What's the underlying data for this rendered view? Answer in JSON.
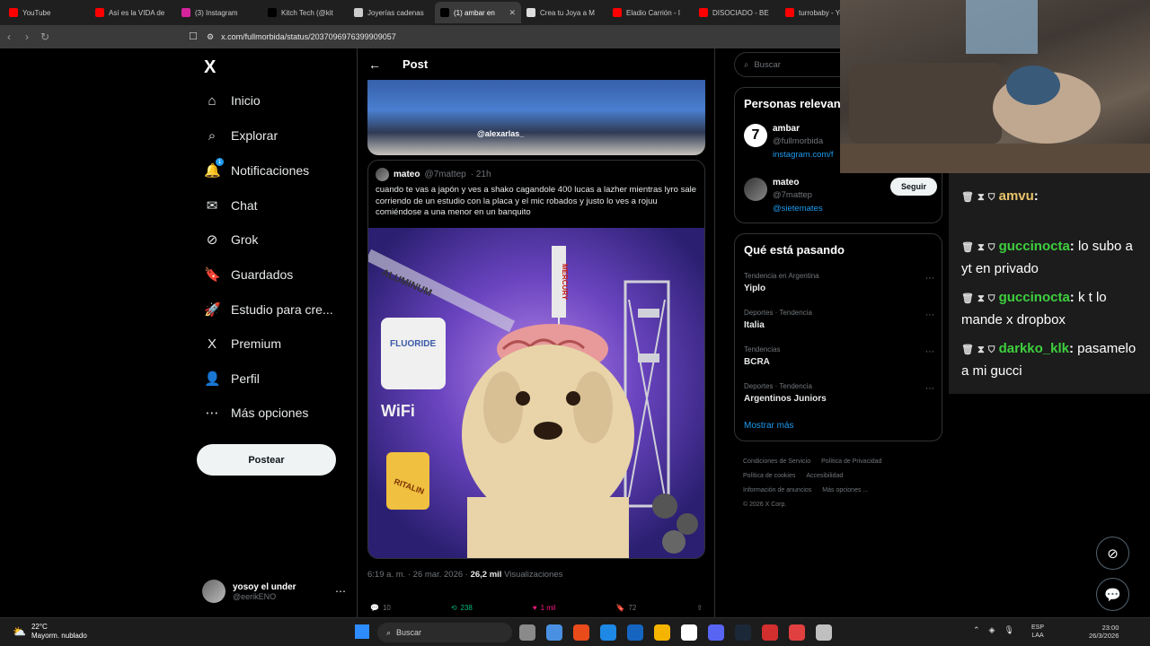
{
  "browser": {
    "tabs": [
      {
        "label": "YouTube",
        "color": "#ff0000"
      },
      {
        "label": "Así es la VIDA de",
        "color": "#ff0000"
      },
      {
        "label": "(3) Instagram",
        "color": "#d6249f"
      },
      {
        "label": "Kitch Tech (@kit",
        "color": "#000000"
      },
      {
        "label": "Joyerías cadenas",
        "color": "#cccccc"
      },
      {
        "label": "(1) ambar en",
        "color": "#000000",
        "active": true
      },
      {
        "label": "Crea tu Joya a M",
        "color": "#dddddd"
      },
      {
        "label": "Eladio Carrión - I",
        "color": "#ff0000"
      },
      {
        "label": "DISOCIADO - BE",
        "color": "#ff0000"
      },
      {
        "label": "turrobaby - You",
        "color": "#ff0000"
      }
    ],
    "url": "x.com/fullmorbida/status/2037096976399909057"
  },
  "sidebar": {
    "logo": "X",
    "items": [
      {
        "label": "Inicio",
        "icon": "home-icon",
        "glyph": "⌂"
      },
      {
        "label": "Explorar",
        "icon": "search-icon",
        "glyph": "⌕"
      },
      {
        "label": "Notificaciones",
        "icon": "bell-icon",
        "glyph": "🔔",
        "badge": "1"
      },
      {
        "label": "Chat",
        "icon": "mail-icon",
        "glyph": "✉"
      },
      {
        "label": "Grok",
        "icon": "grok-icon",
        "glyph": "⊘"
      },
      {
        "label": "Guardados",
        "icon": "bookmark-icon",
        "glyph": "🔖"
      },
      {
        "label": "Estudio para cre...",
        "icon": "rocket-icon",
        "glyph": "🚀"
      },
      {
        "label": "Premium",
        "icon": "x-icon",
        "glyph": "X"
      },
      {
        "label": "Perfil",
        "icon": "person-icon",
        "glyph": "👤"
      },
      {
        "label": "Más opciones",
        "icon": "more-icon",
        "glyph": "⋯"
      }
    ],
    "post_button": "Postear",
    "account": {
      "name": "yosoy el under",
      "handle": "@eerikENO"
    }
  },
  "main": {
    "title": "Post",
    "top_media_tag": "@alexarlas_",
    "quote": {
      "name": "mateo",
      "handle": "@7mattep",
      "time": "· 21h",
      "text": "cuando te vas a japón y ves a shako cagandole 400 lucas a lazher mientras lyro sale corriendo de un estudio con la placa y el mic robados y justo lo ves a rojuu comiéndose a una menor en un banquito",
      "image_words": [
        "ALUMINUM",
        "FLUORIDE",
        "MERCURY",
        "WiFi",
        "RITALIN"
      ]
    },
    "meta": {
      "time": "6:19 a. m. · 26 mar. 2026 ·",
      "views": "26,2 mil",
      "views_label": "Visualizaciones"
    },
    "actions": {
      "replies": "10",
      "reposts": "238",
      "likes": "1 mil",
      "bookmarks": "72"
    }
  },
  "right": {
    "search_placeholder": "Buscar",
    "people_title": "Personas relevan",
    "people": [
      {
        "name": "ambar",
        "handle": "@fullmorbida",
        "link": "instagram.com/f"
      },
      {
        "name": "mateo",
        "handle": "@7mattep",
        "link": "@sietemates",
        "follow": "Seguir"
      }
    ],
    "trends_title": "Qué está pasando",
    "trends": [
      {
        "meta": "Tendencia en Argentina",
        "name": "Yiplo"
      },
      {
        "meta": "Deportes · Tendencia",
        "name": "Italia"
      },
      {
        "meta": "Tendencias",
        "name": "BCRA"
      },
      {
        "meta": "Deportes · Tendencia",
        "name": "Argentinos Juniors"
      }
    ],
    "show_more": "Mostrar más",
    "footer": [
      "Condiciones de Servicio",
      "Política de Privacidad",
      "Política de cookies",
      "Accesibilidad",
      "Información de anuncios",
      "Más opciones ...",
      "© 2026 X Corp."
    ]
  },
  "chat": {
    "messages": [
      {
        "user": "amvu",
        "user_color": "#e8c36a",
        "text": ""
      },
      {
        "user": "guccinocta",
        "user_color": "#3ecf3e",
        "text": "lo subo a yt en privado"
      },
      {
        "user": "guccinocta",
        "user_color": "#3ecf3e",
        "text": "k t lo mande x dropbox"
      },
      {
        "user": "darkko_klk",
        "user_color": "#3ecf3e",
        "text": "pasamelo a mi gucci"
      }
    ]
  },
  "taskbar": {
    "weather_temp": "22°C",
    "weather_desc": "Mayorm. nublado",
    "search": "Buscar",
    "lang_top": "ESP",
    "lang_bottom": "LAA",
    "time": "23:00",
    "date": "26/3/2026",
    "app_colors": [
      "#8a8a8a",
      "#4a90e2",
      "#e94b1b",
      "#1e88e5",
      "#1565c0",
      "#f4b400",
      "#ffffff",
      "#5865f2",
      "#1b2838",
      "#d32f2f",
      "#e04040",
      "#c0c0c0"
    ]
  }
}
